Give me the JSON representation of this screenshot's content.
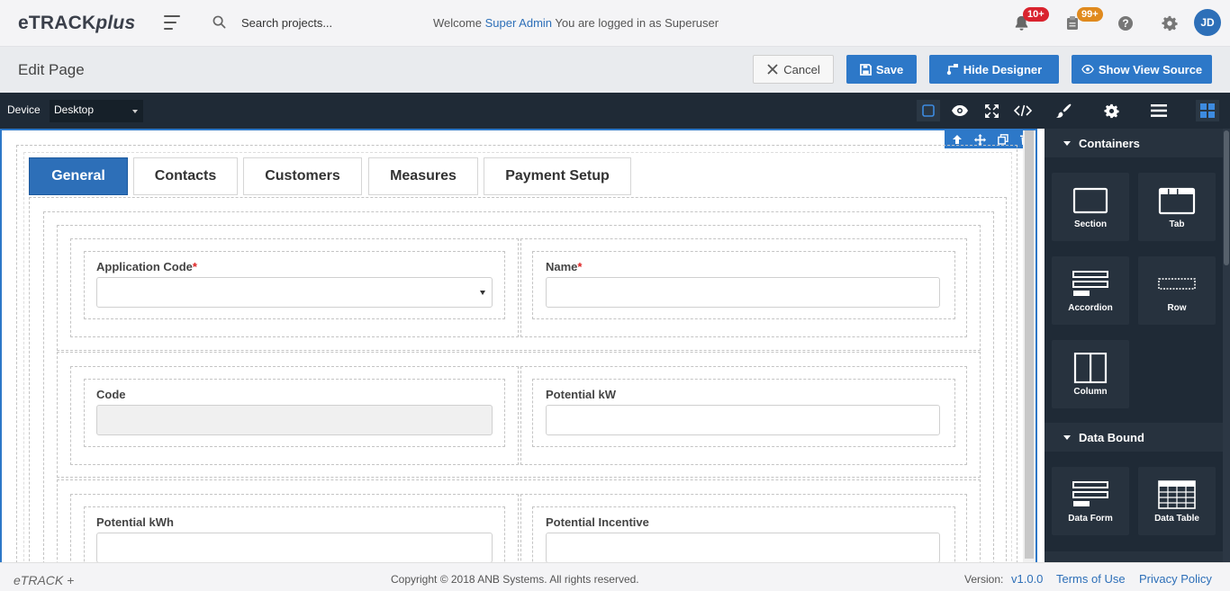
{
  "app": {
    "brand_main": "eTRACK",
    "brand_suffix": "plus"
  },
  "topbar": {
    "search_placeholder": "Search projects...",
    "welcome_prefix": "Welcome",
    "user_name": "Super Admin",
    "welcome_suffix": "You are logged in as Superuser",
    "notifications_badge": "10+",
    "messages_badge": "99+",
    "avatar_initials": "JD",
    "colors": {
      "accent": "#2d78c8",
      "badge_red": "#d9232e",
      "badge_orange": "#e08a1e"
    }
  },
  "page_header": {
    "title": "Edit Page",
    "cancel_label": "Cancel",
    "save_label": "Save",
    "hide_designer_label": "Hide Designer",
    "show_view_source_label": "Show View Source"
  },
  "toolbar": {
    "device_label": "Device",
    "device_value": "Desktop",
    "icons": [
      "select-square-icon",
      "eye-icon",
      "fullscreen-icon",
      "code-icon",
      "brush-icon",
      "gear-icon",
      "menu-lines-icon",
      "grid-blocks-icon"
    ]
  },
  "form": {
    "tabs": [
      {
        "label": "General",
        "active": true
      },
      {
        "label": "Contacts",
        "active": false
      },
      {
        "label": "Customers",
        "active": false
      },
      {
        "label": "Measures",
        "active": false
      },
      {
        "label": "Payment Setup",
        "active": false
      }
    ],
    "fields": {
      "application_code": {
        "label": "Application Code",
        "required": "*",
        "value": ""
      },
      "name": {
        "label": "Name",
        "required": "*",
        "value": ""
      },
      "code": {
        "label": "Code",
        "value": ""
      },
      "potential_kw": {
        "label": "Potential kW",
        "value": ""
      },
      "potential_kwh": {
        "label": "Potential kWh",
        "value": ""
      },
      "potential_incentive": {
        "label": "Potential Incentive",
        "value": ""
      }
    }
  },
  "sidebar": {
    "containers_heading": "Containers",
    "containers": [
      {
        "label": "Section",
        "icon": "section-icon"
      },
      {
        "label": "Tab",
        "icon": "tab-icon"
      },
      {
        "label": "Accordion",
        "icon": "accordion-icon"
      },
      {
        "label": "Row",
        "icon": "row-icon"
      },
      {
        "label": "Column",
        "icon": "column-icon"
      }
    ],
    "data_bound_heading": "Data Bound",
    "data_bound": [
      {
        "label": "Data Form",
        "icon": "data-form-icon"
      },
      {
        "label": "Data Table",
        "icon": "data-table-icon"
      }
    ]
  },
  "footer": {
    "logo_text": "eTRACK +",
    "copyright": "Copyright © 2018 ANB Systems. All rights reserved.",
    "version_label": "Version:",
    "version_value": "v1.0.0",
    "terms_label": "Terms of Use",
    "privacy_label": "Privacy Policy"
  }
}
